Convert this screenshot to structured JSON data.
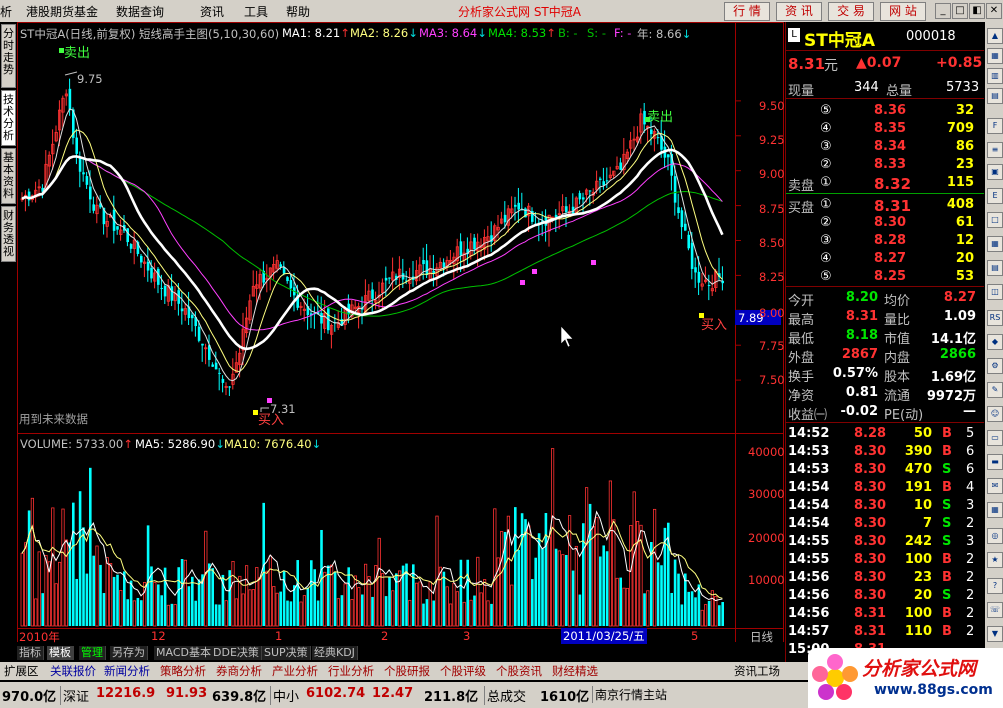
{
  "menu": {
    "items": [
      "析",
      "港股期货基金",
      "数据查询",
      "资讯",
      "工具",
      "帮助"
    ],
    "center_title": "分析家公式网  ST中冠A",
    "right_buttons": [
      "行 情",
      "资 讯",
      "交 易",
      "网 站"
    ]
  },
  "left_tabs": [
    "分时走势",
    "技术分析",
    "基本资料",
    "财务透视"
  ],
  "chart_header": {
    "title": "ST中冠A(日线,前复权) 短线高手主图(5,10,30,60)",
    "ma1": "MA1: 8.21",
    "ma2": "MA2: 8.26",
    "ma3": "MA3: 8.64",
    "ma4": "MA4: 8.53",
    "b": "B: -",
    "s": "S: -",
    "f": "F: -",
    "year": "年: 8.66"
  },
  "annotations": {
    "sell1": "卖出",
    "sell2": "卖出",
    "buy1": "买入",
    "buy2": "买入",
    "high": "9.75",
    "low": "7.31",
    "future_hint": "用到未来数据",
    "price_tag": "7.89"
  },
  "price_axis": [
    "9.50",
    "9.25",
    "9.00",
    "8.75",
    "8.50",
    "8.25",
    "8.00",
    "7.75",
    "7.50"
  ],
  "volume_header": {
    "title": "VOLUME: 5733.00",
    "ma5": "MA5: 5286.90",
    "ma10": "MA10: 7676.40"
  },
  "volume_axis": [
    "40000",
    "30000",
    "20000",
    "10000"
  ],
  "date_axis": {
    "labels": [
      "2010年",
      "12",
      "1",
      "2",
      "3",
      "4",
      "5"
    ],
    "cursor": "2011/03/25/五",
    "period": "日线"
  },
  "bottom_tabs": [
    "指标",
    "模板",
    "管理",
    "另存为",
    "MACD基本",
    "DDE决策",
    "SUP决策",
    "经典KDJ"
  ],
  "quote": {
    "code_name": "ST中冠A",
    "code": "000018",
    "price": "8.31",
    "unit": "元",
    "change": "▲0.07",
    "change_pct": "+0.85",
    "now_vol_label": "现量",
    "now_vol": "344",
    "total_vol_label": "总量",
    "total_vol": "5733",
    "asks": [
      {
        "lvl": "⑤",
        "price": "8.36",
        "vol": "32"
      },
      {
        "lvl": "④",
        "price": "8.35",
        "vol": "709"
      },
      {
        "lvl": "③",
        "price": "8.34",
        "vol": "86"
      },
      {
        "lvl": "②",
        "price": "8.33",
        "vol": "23"
      },
      {
        "lvl": "①",
        "price": "8.32",
        "vol": "115"
      }
    ],
    "ask_label": "卖盘",
    "bid_label": "买盘",
    "bids": [
      {
        "lvl": "①",
        "price": "8.31",
        "vol": "408"
      },
      {
        "lvl": "②",
        "price": "8.30",
        "vol": "61"
      },
      {
        "lvl": "③",
        "price": "8.28",
        "vol": "12"
      },
      {
        "lvl": "④",
        "price": "8.27",
        "vol": "20"
      },
      {
        "lvl": "⑤",
        "price": "8.25",
        "vol": "53"
      }
    ],
    "stats": [
      [
        "今开",
        "8.20",
        "均价",
        "8.27"
      ],
      [
        "最高",
        "8.31",
        "量比",
        "1.09"
      ],
      [
        "最低",
        "8.18",
        "市值",
        "14.1亿"
      ],
      [
        "外盘",
        "2867",
        "内盘",
        "2866"
      ],
      [
        "换手",
        "0.57%",
        "股本",
        "1.69亿"
      ],
      [
        "净资",
        "0.81",
        "流通",
        "9972万"
      ],
      [
        "收益㈠",
        "-0.02",
        "PE(动)",
        "—"
      ]
    ]
  },
  "ticks": [
    [
      "14:52",
      "8.28",
      "50",
      "B",
      "5"
    ],
    [
      "14:53",
      "8.30",
      "390",
      "B",
      "6"
    ],
    [
      "14:53",
      "8.30",
      "470",
      "S",
      "6"
    ],
    [
      "14:54",
      "8.30",
      "191",
      "B",
      "4"
    ],
    [
      "14:54",
      "8.30",
      "10",
      "S",
      "3"
    ],
    [
      "14:54",
      "8.30",
      "7",
      "S",
      "2"
    ],
    [
      "14:55",
      "8.30",
      "242",
      "S",
      "3"
    ],
    [
      "14:55",
      "8.30",
      "100",
      "B",
      "2"
    ],
    [
      "14:56",
      "8.30",
      "23",
      "B",
      "2"
    ],
    [
      "14:56",
      "8.30",
      "20",
      "S",
      "2"
    ],
    [
      "14:56",
      "8.31",
      "100",
      "B",
      "2"
    ],
    [
      "14:57",
      "8.31",
      "110",
      "B",
      "2"
    ],
    [
      "15:00",
      "8.31",
      "",
      "",
      ""
    ]
  ],
  "function_bar": [
    "扩展区",
    "关联报价",
    "新闻分析",
    "策略分析",
    "券商分析",
    "产业分析",
    "行业分析",
    "个股研报",
    "个股评级",
    "个股资讯",
    "财经精选"
  ],
  "function_right": "资讯工场",
  "status": {
    "s1": "970.0亿",
    "s2_label": "深证",
    "s2_val": "12216.9",
    "s2_chg": "91.93",
    "s2_amt": "639.8亿",
    "s3_label": "中小",
    "s3_val": "6102.74",
    "s3_chg": "12.47",
    "s3_amt": "211.8亿",
    "s4_label": "总成交",
    "s4_val": "1610亿",
    "server": "南京行情主站"
  },
  "watermark": {
    "title": "分析家公式网",
    "url": "www.88gs.com"
  },
  "colors": {
    "up": "#ff3232",
    "down": "#00ffff",
    "ma_white": "#ffffff",
    "ma_yellow": "#ffff80",
    "ma_magenta": "#ff40ff",
    "ma_green": "#00c000"
  }
}
